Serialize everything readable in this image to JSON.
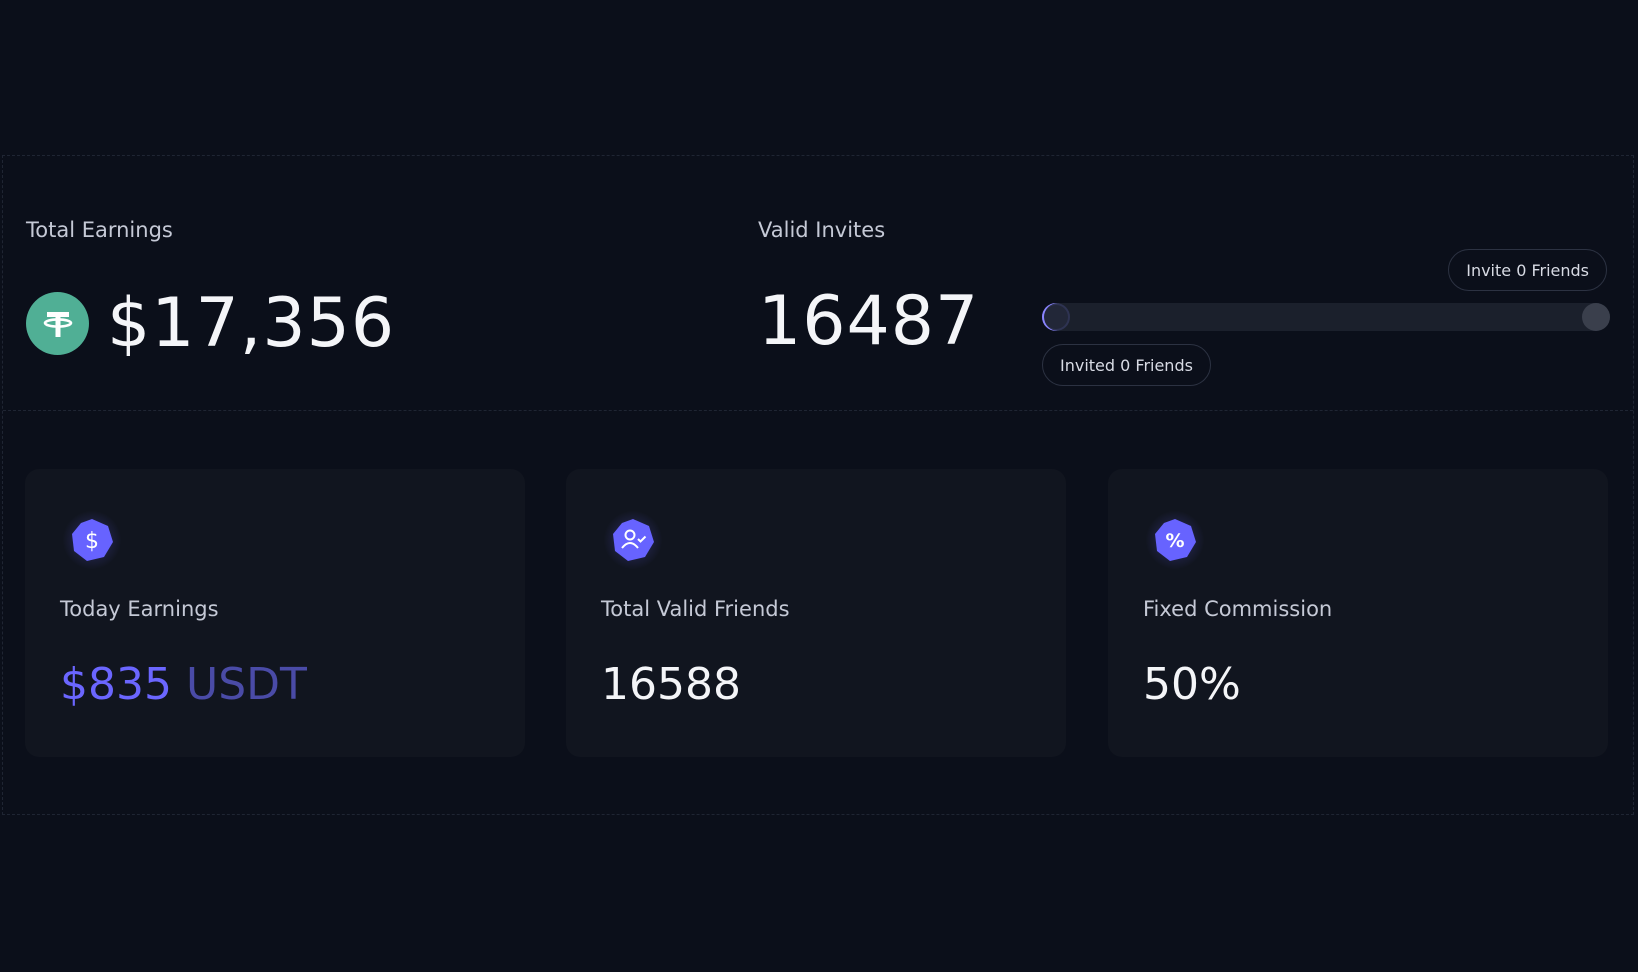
{
  "total_earnings": {
    "label": "Total Earnings",
    "value": "$17,356",
    "icon": "tether-icon"
  },
  "valid_invites": {
    "label": "Valid Invites",
    "value": "16487",
    "progress": 0,
    "invite_pill": "Invite 0 Friends",
    "invited_pill": "Invited 0 Friends"
  },
  "cards": [
    {
      "icon": "dollar-icon",
      "label": "Today Earnings",
      "amount": "$835",
      "unit": "USDT"
    },
    {
      "icon": "user-check-icon",
      "label": "Total Valid Friends",
      "value": "16588"
    },
    {
      "icon": "percent-icon",
      "label": "Fixed Commission",
      "value": "50%"
    }
  ],
  "colors": {
    "background": "#0b0f1a",
    "card": "#11151f",
    "accent": "#6b66ff",
    "tether": "#50af95"
  }
}
